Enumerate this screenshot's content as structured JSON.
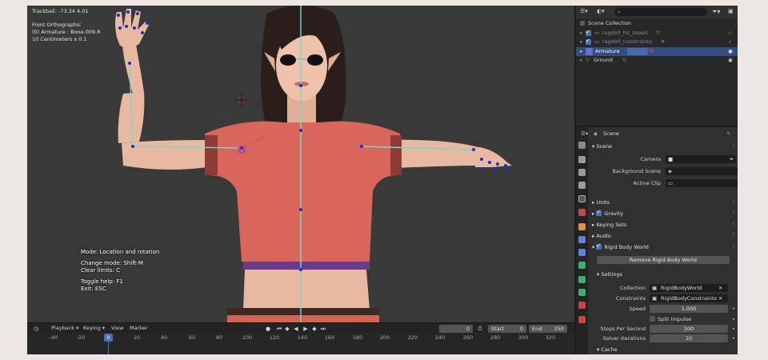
{
  "viewport": {
    "info_line1": "Trackball: -73.34 4.01",
    "info_line2": "Front Orthographic",
    "info_line3": "(0) Armature : Bone.009.R",
    "info_line4": "10 Centimeters x 0.1",
    "overlay": {
      "mode": "Mode: Location and rotation",
      "change_mode": "Change mode: Shift-M",
      "clear_limits": "Clear limits: C",
      "toggle_help": "Toggle help: F1",
      "exit": "Exit: ESC"
    }
  },
  "timeline": {
    "menus": [
      "Playback",
      "Keying",
      "View",
      "Marker"
    ],
    "current_frame": "0",
    "start_label": "Start",
    "start_value": "0",
    "end_label": "End",
    "end_value": "250",
    "ticks": [
      "-40",
      "-20",
      "20",
      "40",
      "60",
      "80",
      "100",
      "120",
      "140",
      "160",
      "180",
      "200",
      "220",
      "240",
      "260",
      "280",
      "300",
      "320"
    ],
    "playhead": "0"
  },
  "outliner": {
    "root": "Scene Collection",
    "items": [
      {
        "label": "ragdoll_hit_boxes",
        "checked": true,
        "icon": "collection-icon"
      },
      {
        "label": "ragdoll_constraints",
        "checked": true,
        "icon": "collection-icon"
      },
      {
        "label": "Armature",
        "selected": true,
        "icon": "armature-icon"
      },
      {
        "label": "Ground",
        "icon": "mesh-icon"
      }
    ]
  },
  "properties": {
    "context": "Scene",
    "scene_panel": "Scene",
    "camera_label": "Camera",
    "bg_scene_label": "Background Scene",
    "active_clip_label": "Active Clip",
    "units": "Units",
    "gravity": "Gravity",
    "keying_sets": "Keying Sets",
    "audio": "Audio",
    "rigid_body_world": "Rigid Body World",
    "remove_button": "Remove Rigid Body World",
    "settings": "Settings",
    "collection_label": "Collection",
    "collection_value": "RigidBodyWorld",
    "constraints_label": "Constraints",
    "constraints_value": "RigidBodyConstraints",
    "speed_label": "Speed",
    "speed_value": "1.000",
    "split_impulse": "Split Impulse",
    "steps_label": "Steps Per Second",
    "steps_value": "100",
    "solver_label": "Solver Iterations",
    "solver_value": "10",
    "cache": "Cache"
  },
  "colors": {
    "accent": "#4772b3",
    "shirt": "#d9665a",
    "skin": "#e8b9a0",
    "bone": "#7fd6c8",
    "joint": "#1a2fd0"
  }
}
